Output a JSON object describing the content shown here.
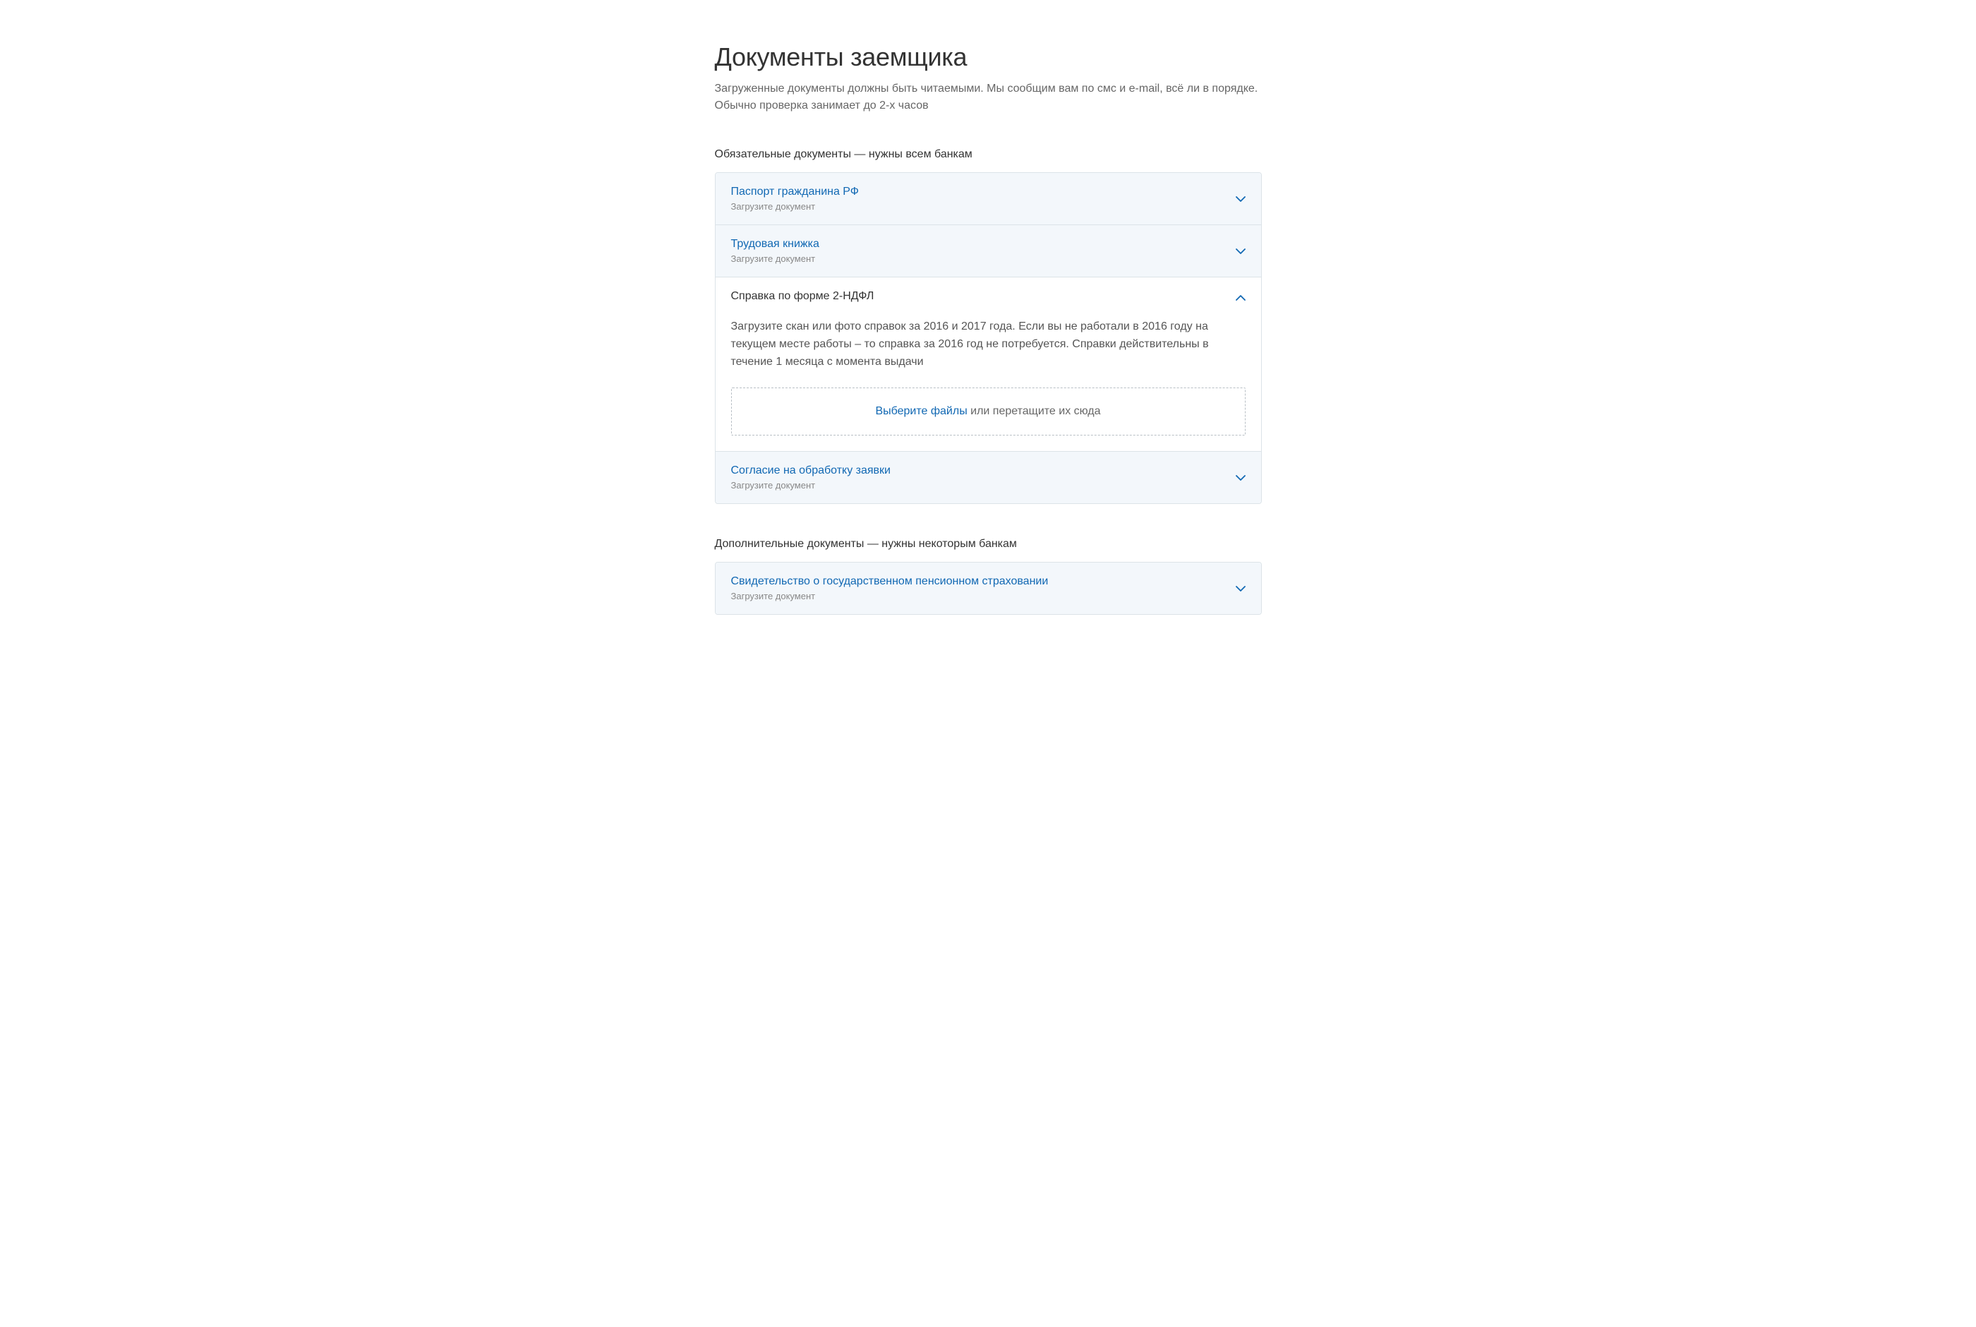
{
  "page": {
    "title": "Документы заемщика",
    "subtitle": "Загруженные документы должны быть читаемыми. Мы сообщим вам по смс и e-mail, всё ли в порядке. Обычно проверка занимает до 2-х часов"
  },
  "sections": {
    "required": {
      "title": "Обязательные документы — нужны всем банкам",
      "items": [
        {
          "title": "Паспорт гражданина РФ",
          "hint": "Загрузите документ"
        },
        {
          "title": "Трудовая книжка",
          "hint": "Загрузите документ"
        },
        {
          "title": "Справка по форме 2-НДФЛ",
          "description": "Загрузите скан или фото справок за 2016 и 2017 года. Если вы не работали в 2016 году на текущем месте работы – то справка за 2016 год не потребуется. Справки действительны в течение 1 месяца с момента выдачи",
          "dropzone_link": "Выберите файлы",
          "dropzone_text": " или перетащите их сюда"
        },
        {
          "title": "Согласие на обработку заявки",
          "hint": "Загрузите документ"
        }
      ]
    },
    "optional": {
      "title": "Дополнительные документы — нужны некоторым банкам",
      "items": [
        {
          "title": "Свидетельство о государственном пенсионном страховании",
          "hint": "Загрузите документ"
        }
      ]
    }
  }
}
